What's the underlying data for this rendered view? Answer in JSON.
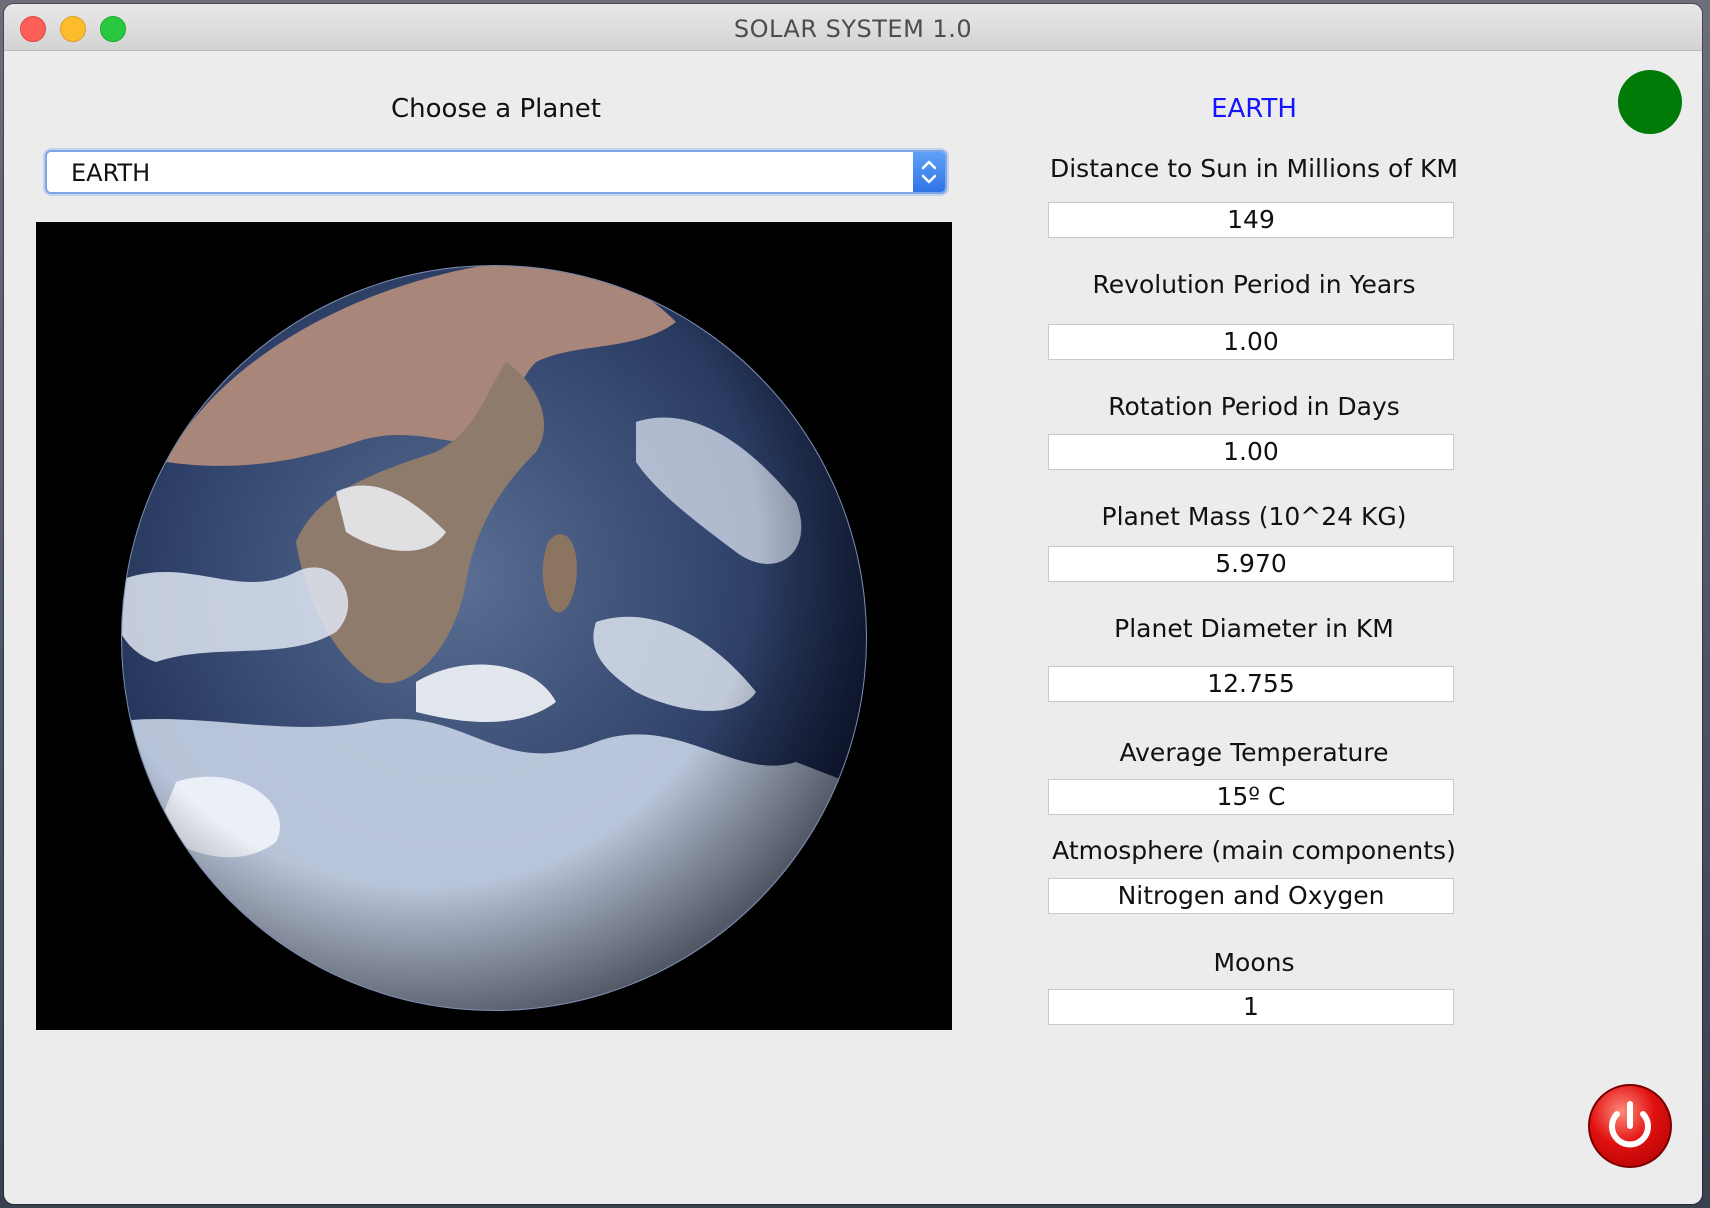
{
  "window": {
    "title": "SOLAR SYSTEM 1.0"
  },
  "selector": {
    "label": "Choose a Planet",
    "selected": "EARTH"
  },
  "image": {
    "subject": "earth-globe-photo"
  },
  "details": {
    "planet_name": "EARTH",
    "fields": [
      {
        "label": "Distance to Sun in Millions of KM",
        "value": "149"
      },
      {
        "label": "Revolution Period in Years",
        "value": "1.00"
      },
      {
        "label": "Rotation Period in Days",
        "value": "1.00"
      },
      {
        "label": "Planet Mass (10^24 KG)",
        "value": "5.970"
      },
      {
        "label": "Planet Diameter in KM",
        "value": "12.755"
      },
      {
        "label": "Average Temperature",
        "value": "15º C"
      },
      {
        "label": "Atmosphere (main components)",
        "value": "Nitrogen and Oxygen"
      },
      {
        "label": "Moons",
        "value": "1"
      }
    ]
  },
  "colors": {
    "planet_name": "#1414ff",
    "status": "#007b08",
    "power": "#e01010"
  },
  "icons": {
    "status": "status-indicator-icon",
    "power": "power-icon",
    "select_arrows": "chevron-updown-icon"
  }
}
